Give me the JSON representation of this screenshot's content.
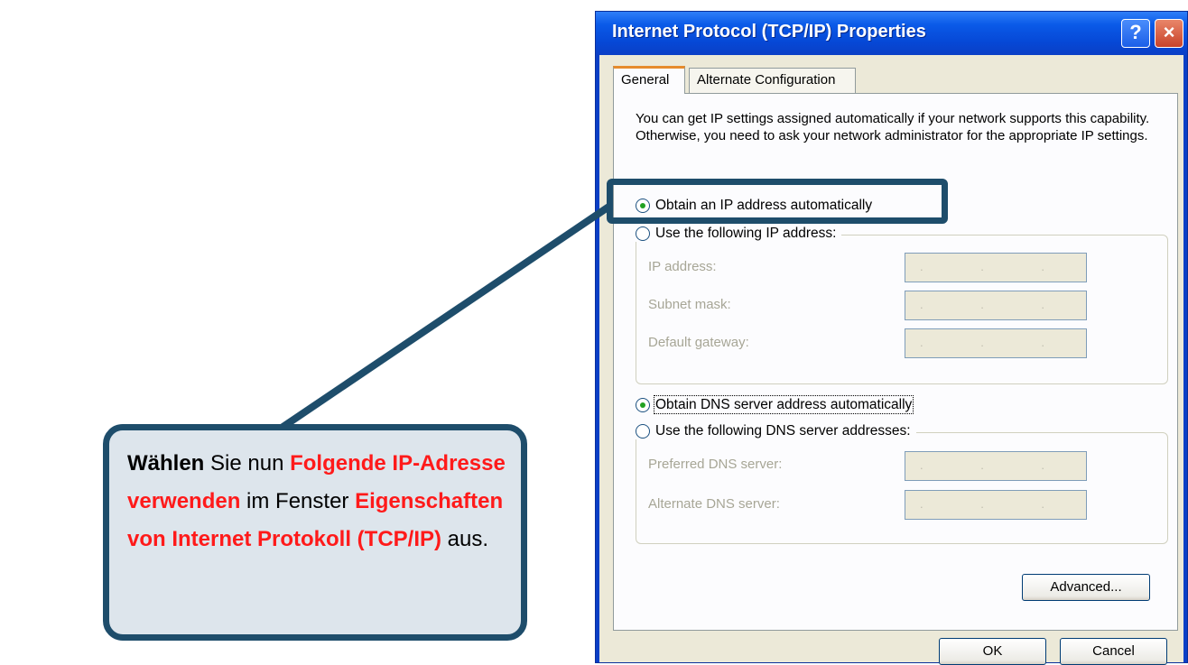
{
  "dialog": {
    "title": "Internet Protocol (TCP/IP) Properties",
    "help_label": "?",
    "close_label": "×",
    "tabs": [
      "General",
      "Alternate Configuration"
    ],
    "intro": "You can get IP settings assigned automatically if your network supports this capability. Otherwise, you need to ask your network administrator for the appropriate IP settings.",
    "ip_auto_label": "Obtain an IP address automatically",
    "ip_manual_label": "Use the following IP address:",
    "ip_fields": {
      "ip_address": {
        "label": "IP address:",
        "value": ". . ."
      },
      "subnet_mask": {
        "label": "Subnet mask:",
        "value": ". . ."
      },
      "default_gateway": {
        "label": "Default gateway:",
        "value": ". . ."
      }
    },
    "dns_auto_label": "Obtain DNS server address automatically",
    "dns_manual_label": "Use the following DNS server addresses:",
    "dns_fields": {
      "preferred": {
        "label": "Preferred DNS server:",
        "value": ". . ."
      },
      "alternate": {
        "label": "Alternate DNS server:",
        "value": ". . ."
      }
    },
    "advanced_label": "Advanced...",
    "ok_label": "OK",
    "cancel_label": "Cancel"
  },
  "callout": {
    "part1": "Wählen",
    "part2": " Sie nun ",
    "part3": "Folgende IP-Adresse verwenden",
    "part4": " im Fenster ",
    "part5": "Eigenschaften von Internet Protokoll (TCP/IP)",
    "part6": " aus."
  },
  "colors": {
    "callout_border": "#1e4d6b",
    "callout_fill": "#dde5ec",
    "callout_red": "#ff1a1a",
    "titlebar": "#0a5ae8"
  }
}
